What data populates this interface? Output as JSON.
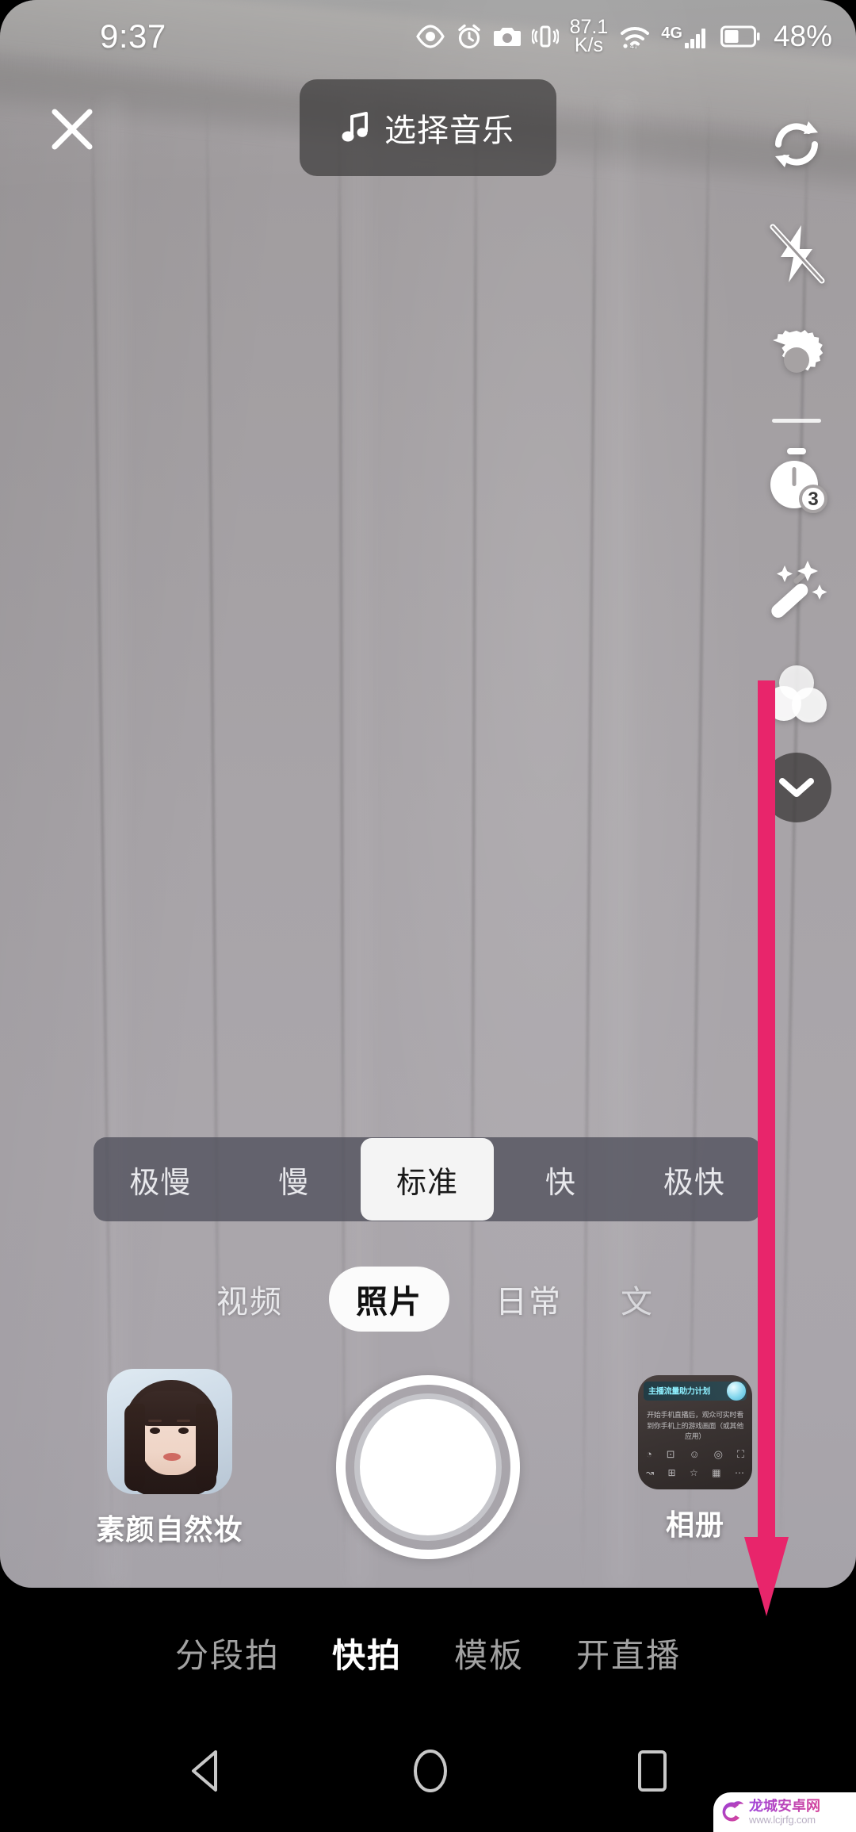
{
  "status_bar": {
    "time": "9:37",
    "network_speed_value": "87.1",
    "network_speed_unit": "K/s",
    "mobile_network": "4G",
    "battery_percent": "48%",
    "icons": [
      "eye-comfort-icon",
      "alarm-icon",
      "camera-icon",
      "vibrate-icon",
      "wifi-icon",
      "signal-bars-icon",
      "battery-icon"
    ]
  },
  "top_bar": {
    "close_icon": "close-icon",
    "music_icon": "music-note-icon",
    "music_label": "选择音乐"
  },
  "side_rail": {
    "items": [
      {
        "name": "flip-camera",
        "icon": "flip-camera-icon"
      },
      {
        "name": "flash",
        "icon": "flash-off-icon"
      },
      {
        "name": "settings",
        "icon": "gear-icon"
      },
      {
        "name": "timer",
        "icon": "timer-icon",
        "value": "3"
      },
      {
        "name": "beautify",
        "icon": "magic-wand-icon"
      },
      {
        "name": "filters",
        "icon": "filter-circles-icon"
      },
      {
        "name": "collapse",
        "icon": "chevron-down-icon"
      }
    ]
  },
  "speed_bar": {
    "options": [
      "极慢",
      "慢",
      "标准",
      "快",
      "极快"
    ],
    "selected_index": 2
  },
  "mode_tabs": {
    "items": [
      "视频",
      "照片",
      "日常",
      "文"
    ],
    "selected_index": 1
  },
  "capture_row": {
    "effect_label": "素颜自然妆",
    "shutter_name": "shutter-button",
    "album_label": "相册",
    "album_banner_text": "主播流量助力计划",
    "album_body_text": "开始手机直播后，观众可实时看到你手机上的游戏画面（或其他应用）"
  },
  "bottom_nav": {
    "items": [
      "分段拍",
      "快拍",
      "模板",
      "开直播"
    ],
    "selected_index": 1
  },
  "system_nav": {
    "items": [
      "back-button",
      "home-button",
      "recents-button"
    ]
  },
  "annotation": {
    "arrow_color": "#E8256B",
    "points_to": "开直播"
  },
  "watermark": {
    "site_name": "龙城安卓网",
    "url": "www.lcjrfg.com"
  },
  "colors": {
    "accent_pink": "#E8256B",
    "selected_chip_bg": "#FBFBFB",
    "overlay_dark": "rgba(60,58,58,0.72)"
  }
}
